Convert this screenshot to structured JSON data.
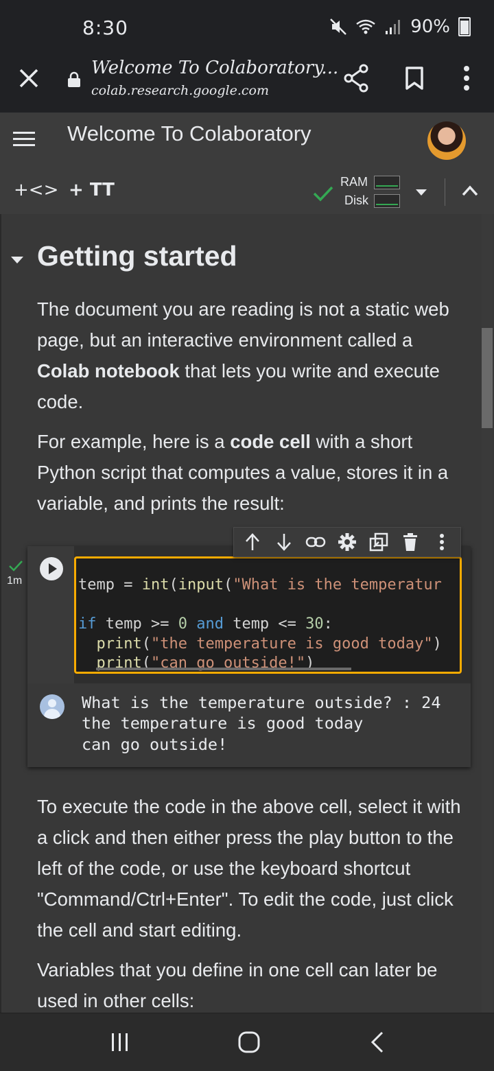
{
  "status_bar": {
    "time": "8:30",
    "battery": "90%"
  },
  "browser": {
    "title": "Welcome To Colaboratory...",
    "url": "colab.research.google.com"
  },
  "app": {
    "title": "Welcome To Colaboratory"
  },
  "toolbar": {
    "add_code": "+<>",
    "add_text": "+ TT",
    "ram_label": "RAM",
    "disk_label": "Disk"
  },
  "section": {
    "title": "Getting started",
    "para1_a": "The document you are reading is not a static web page, but an interactive environment called a ",
    "para1_bold": "Colab notebook",
    "para1_b": " that lets you write and execute code.",
    "para2_a": "For example, here is a ",
    "para2_bold": "code cell",
    "para2_b": " with a short Python script that computes a value, stores it in a variable, and prints the result:",
    "para3": "To execute the code in the above cell, select it with a click and then either press the play button to the left of the code, or use the keyboard shortcut \"Command/Ctrl+Enter\". To edit the code, just click the cell and start editing.",
    "para4": "Variables that you define in one cell can later be used in other cells:"
  },
  "cell": {
    "exec_time": "1m",
    "code": {
      "l1_var": "temp",
      "l1_op": " = ",
      "l1_fn1": "int",
      "l1_p1": "(",
      "l1_fn2": "input",
      "l1_p2": "(",
      "l1_str": "\"What is the temperatur",
      "l3_if": "if",
      "l3_a": " temp >= ",
      "l3_n1": "0",
      "l3_and": " and",
      "l3_b": " temp <= ",
      "l3_n2": "30",
      "l3_c": ":",
      "l4_indent": "  ",
      "l4_fn": "print",
      "l4_p": "(",
      "l4_str": "\"the temperature is good today\"",
      "l4_end": ")",
      "l5_indent": "  ",
      "l5_fn": "print",
      "l5_p": "(",
      "l5_str": "\"can go outside!\"",
      "l5_end": ")"
    },
    "output": [
      "What is the temperature outside? : 24",
      "the temperature is good today",
      "can go outside!"
    ]
  },
  "icons": {
    "mute": "mute-icon",
    "wifi": "wifi-icon",
    "signal": "signal-icon",
    "battery": "battery-icon",
    "close": "close-icon",
    "lock": "lock-icon",
    "share": "share-icon",
    "bookmark": "bookmark-icon",
    "more": "more-vert-icon",
    "menu": "menu-icon",
    "check": "check-icon",
    "dropdown": "dropdown-icon",
    "collapse": "chevron-up-icon",
    "move_up": "arrow-up-icon",
    "move_down": "arrow-down-icon",
    "link": "link-icon",
    "settings": "gear-icon",
    "mirror": "mirror-cell-icon",
    "delete": "trash-icon",
    "cell_more": "more-vert-icon",
    "run": "play-icon",
    "output_avatar": "user-icon",
    "nav_recent": "recent-apps-icon",
    "nav_home": "home-icon",
    "nav_back": "back-icon"
  },
  "colors": {
    "accent_border": "#f9ab00",
    "status_ok": "#34a853",
    "background": "#383838"
  }
}
